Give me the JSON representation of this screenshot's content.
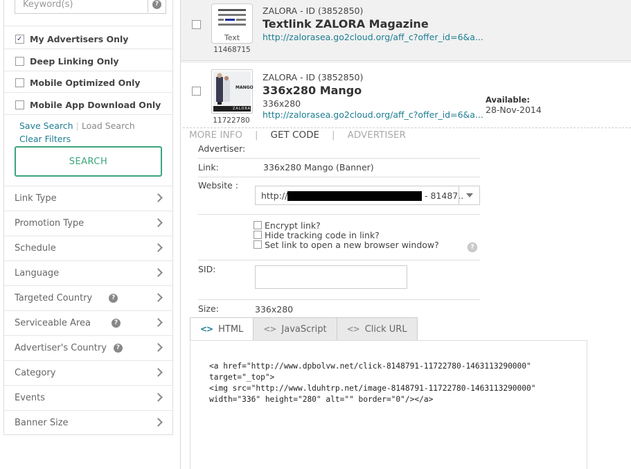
{
  "sidebar": {
    "keyword_placeholder": "Keyword(s)",
    "checkboxes": [
      {
        "label": "My Advertisers Only",
        "checked": true
      },
      {
        "label": "Deep Linking Only",
        "checked": false
      },
      {
        "label": "Mobile Optimized Only",
        "checked": false
      },
      {
        "label": "Mobile App Download Only",
        "checked": false
      }
    ],
    "save_search": "Save Search",
    "load_search": "Load Search",
    "clear_filters": "Clear Filters",
    "search_button": "SEARCH",
    "filters": [
      {
        "label": "Link Type",
        "help": false
      },
      {
        "label": "Promotion Type",
        "help": false
      },
      {
        "label": "Schedule",
        "help": false
      },
      {
        "label": "Language",
        "help": false
      },
      {
        "label": "Targeted Country",
        "help": true
      },
      {
        "label": "Serviceable Area",
        "help": true
      },
      {
        "label": "Advertiser's Country",
        "help": true
      },
      {
        "label": "Category",
        "help": false
      },
      {
        "label": "Events",
        "help": false
      },
      {
        "label": "Banner Size",
        "help": false
      }
    ]
  },
  "results": [
    {
      "thumb_text": "Text",
      "thumb_id": "11468715",
      "advertiser": "ZALORA - ID (3852850)",
      "title": "Textlink ZALORA Magazine",
      "url": "http://zaloraseа.go2cloud.org/aff_c?offer_id=6&a..."
    },
    {
      "thumb_id": "11722780",
      "thumb_brand": "MANGO",
      "thumb_footer": "ZALORA",
      "advertiser": "ZALORA - ID (3852850)",
      "title": "336x280 Mango",
      "size": "336x280",
      "url": "http://zaloraseа.go2cloud.org/aff_c?offer_id=6&a...",
      "available_label": "Available:",
      "available_date": "28-Nov-2014"
    }
  ],
  "detail_tabs": [
    "MORE INFO",
    "GET CODE",
    "ADVERTISER"
  ],
  "detail": {
    "advertiser_label": "Advertiser:",
    "link_label": "Link:",
    "link_value": "336x280 Mango (Banner)",
    "website_label": "Website :",
    "website_prefix": "http://",
    "website_suffix": "- 81487..",
    "options": [
      "Encrypt link?",
      "Hide tracking code in link?",
      "Set link to open a new browser window?"
    ],
    "sid_label": "SID:",
    "size_label": "Size:",
    "size_value": "336x280"
  },
  "code_tabs": [
    {
      "icon": "<>",
      "label": "HTML"
    },
    {
      "icon": "<>",
      "label": "JavaScript"
    },
    {
      "icon": "<>",
      "label": "Click URL"
    }
  ],
  "code": "<a href=\"http://www.dpbolvw.net/click-8148791-11722780-1463113290000\"\ntarget=\"_top\">\n<img src=\"http://www.lduhtrp.net/image-8148791-11722780-1463113290000\"\nwidth=\"336\" height=\"280\" alt=\"\" border=\"0\"/></a>",
  "colors": {
    "accent": "#1c7d92",
    "search_green": "#3aa57a"
  }
}
